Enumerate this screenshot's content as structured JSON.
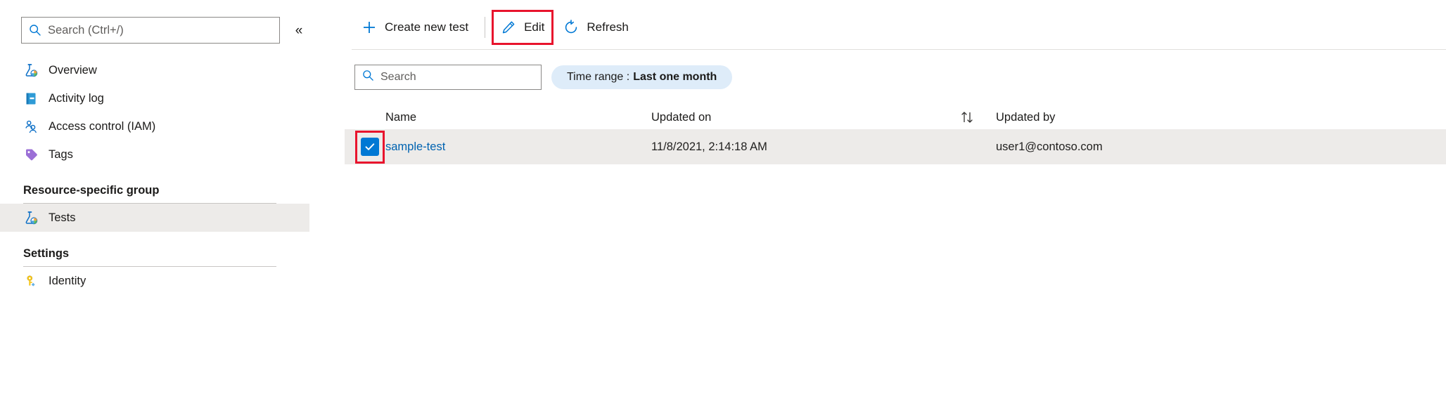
{
  "sidebar": {
    "search": {
      "placeholder": "Search (Ctrl+/)",
      "value": "",
      "icon": "search-icon"
    },
    "collapse_label": "«",
    "items": [
      {
        "label": "Overview",
        "icon": "flask-chart-icon",
        "selected": false
      },
      {
        "label": "Activity log",
        "icon": "activity-log-icon",
        "selected": false
      },
      {
        "label": "Access control (IAM)",
        "icon": "people-icon",
        "selected": false
      },
      {
        "label": "Tags",
        "icon": "tag-icon",
        "selected": false
      }
    ],
    "groups": [
      {
        "title": "Resource-specific group",
        "items": [
          {
            "label": "Tests",
            "icon": "flask-chart-icon",
            "selected": true
          }
        ]
      },
      {
        "title": "Settings",
        "items": [
          {
            "label": "Identity",
            "icon": "key-icon",
            "selected": false
          }
        ]
      }
    ]
  },
  "toolbar": {
    "create_label": "Create new test",
    "create_icon": "plus-icon",
    "edit_label": "Edit",
    "edit_icon": "pencil-icon",
    "refresh_label": "Refresh",
    "refresh_icon": "refresh-icon"
  },
  "filters": {
    "search": {
      "placeholder": "Search",
      "value": "",
      "icon": "search-icon"
    },
    "time_range": {
      "label": "Time range : ",
      "value": "Last one month"
    }
  },
  "table": {
    "columns": {
      "name": "Name",
      "updated_on": "Updated on",
      "sort_icon": "sort-arrows-icon",
      "updated_by": "Updated by"
    },
    "rows": [
      {
        "checked": true,
        "name": "sample-test",
        "updated_on": "11/8/2021, 2:14:18 AM",
        "updated_by": "user1@contoso.com"
      }
    ]
  },
  "colors": {
    "accent": "#0078d4",
    "link": "#0063b1",
    "highlight_box": "#e8142d",
    "row_selected_bg": "#edebe9",
    "pill_bg": "#deecf9"
  }
}
